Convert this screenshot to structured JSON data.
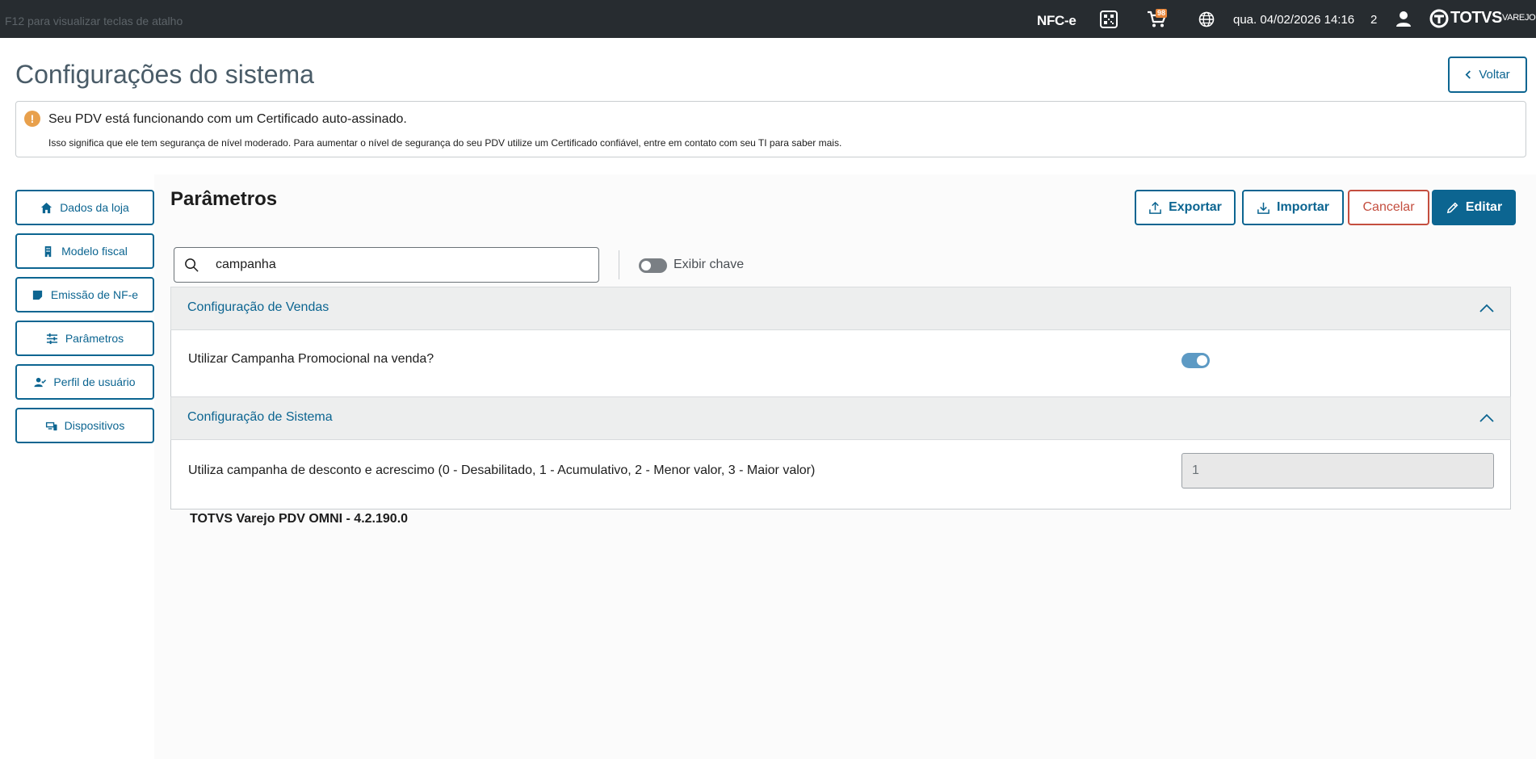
{
  "topbar": {
    "hint": "F12 para visualizar teclas de atalho",
    "nfce_label": "NFC-e",
    "cart_badge": "98",
    "datetime": "qua. 04/02/2026 14:16",
    "count": "2",
    "brand": "TOTVS",
    "brand_sub": "VAREJO"
  },
  "header": {
    "title": "Configurações do sistema",
    "back_label": "Voltar"
  },
  "alert": {
    "title": "Seu PDV está funcionando com um Certificado auto-assinado.",
    "description": "Isso significa que ele tem segurança de nível moderado. Para aumentar o nível de segurança do seu PDV utilize um Certificado confiável, entre em contato com seu TI para saber mais."
  },
  "sidebar": {
    "items": [
      {
        "label": "Dados da loja",
        "icon": "home-icon"
      },
      {
        "label": "Modelo fiscal",
        "icon": "building-icon"
      },
      {
        "label": "Emissão de NF-e",
        "icon": "note-icon"
      },
      {
        "label": "Parâmetros",
        "icon": "sliders-icon"
      },
      {
        "label": "Perfil de usuário",
        "icon": "user-check-icon"
      },
      {
        "label": "Dispositivos",
        "icon": "devices-icon"
      }
    ]
  },
  "panel": {
    "title": "Parâmetros",
    "export_label": "Exportar",
    "import_label": "Importar",
    "cancel_label": "Cancelar",
    "edit_label": "Editar",
    "search_value": "campanha",
    "show_key_label": "Exibir chave",
    "show_key_on": false,
    "groups": [
      {
        "title": "Configuração de Vendas",
        "rows": [
          {
            "label": "Utilizar Campanha Promocional na venda?",
            "type": "toggle",
            "value": true
          }
        ]
      },
      {
        "title": "Configuração de Sistema",
        "rows": [
          {
            "label": "Utiliza campanha de desconto e acrescimo (0 - Desabilitado, 1 - Acumulativo, 2 - Menor valor, 3 - Maior valor)",
            "type": "input",
            "value": "1"
          }
        ]
      }
    ]
  },
  "footer": {
    "version": "TOTVS Varejo PDV OMNI - 4.2.190.0"
  },
  "colors": {
    "primary": "#0c6591",
    "topbar": "#272c30",
    "danger": "#c44e3f",
    "warning": "#e8a04c"
  }
}
